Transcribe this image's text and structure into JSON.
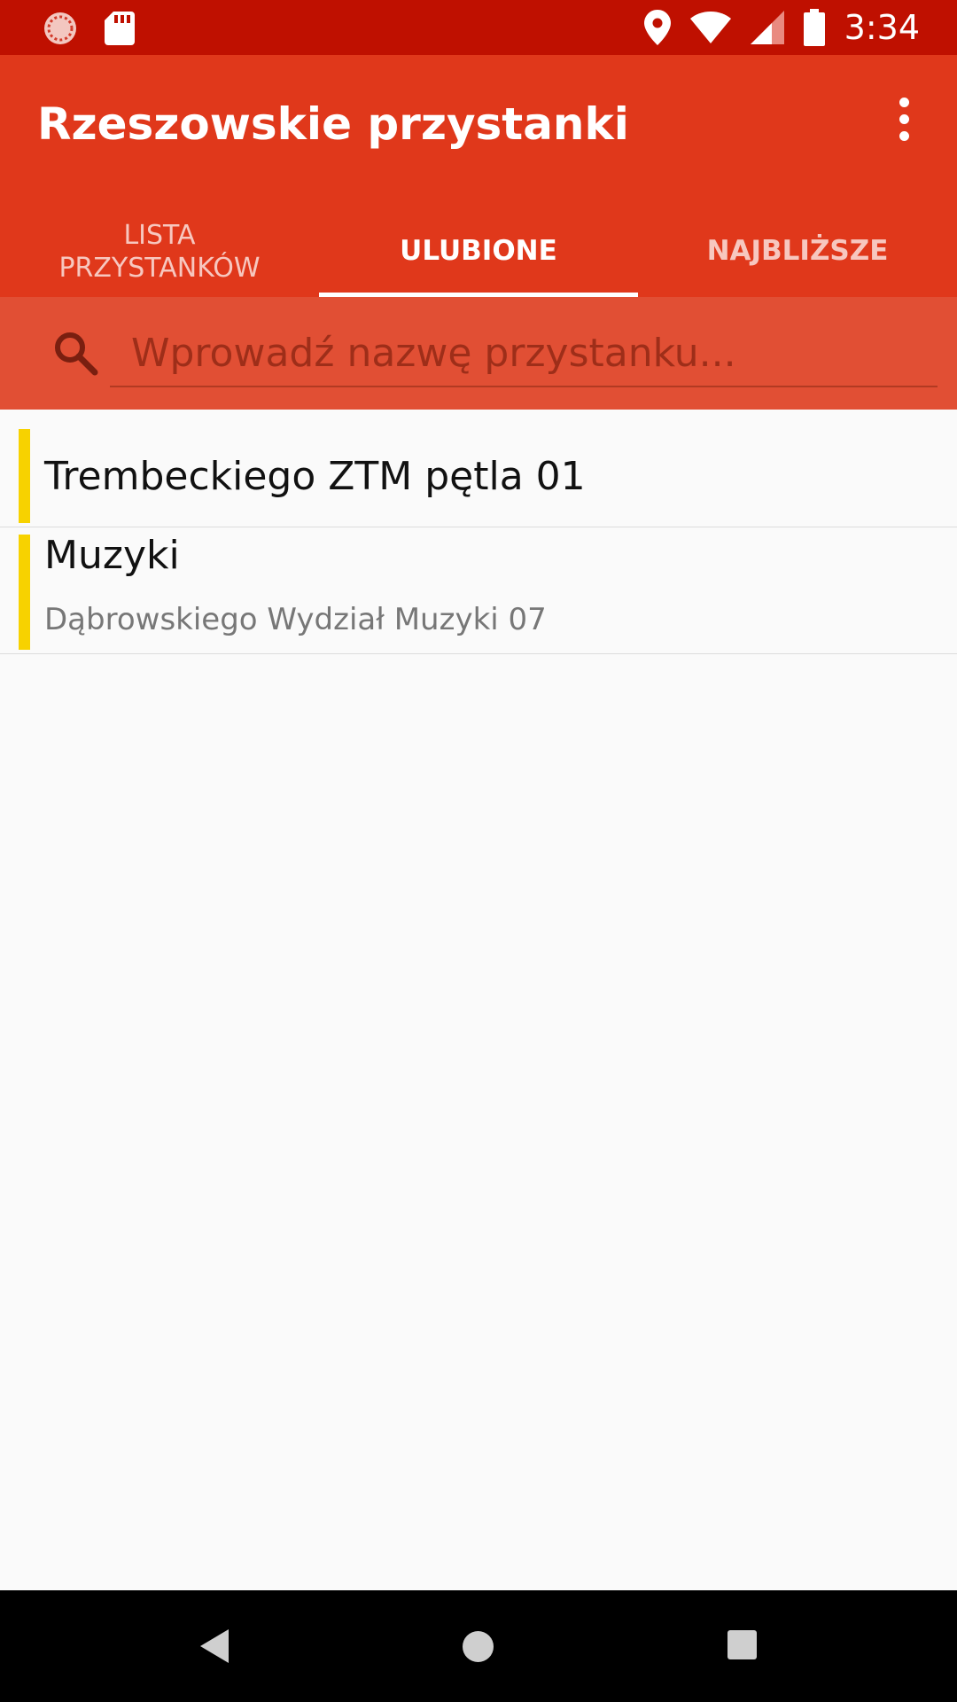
{
  "status_bar": {
    "time": "3:34",
    "left_icons": [
      "notification-dial-icon",
      "sd-card-icon"
    ],
    "right_icons": [
      "location-pin-icon",
      "wifi-icon",
      "signal-icon",
      "battery-icon"
    ]
  },
  "app_bar": {
    "title": "Rzeszowskie przystanki",
    "menu_icon": "more-vert-icon"
  },
  "tabs": [
    {
      "label": "LISTA PRZYSTANKÓW",
      "active": false
    },
    {
      "label": "ULUBIONE",
      "active": true
    },
    {
      "label": "NAJBLIŻSZE",
      "active": false
    }
  ],
  "search": {
    "placeholder": "Wprowadź nazwę przystanku...",
    "value": "",
    "icon": "search-icon"
  },
  "favorites": [
    {
      "title": "Trembeckiego ZTM pętla 01",
      "subtitle": ""
    },
    {
      "title": "Muzyki",
      "subtitle": "Dąbrowskiego Wydział Muzyki 07"
    }
  ],
  "colors": {
    "status_bar": "#bf1000",
    "app_bar": "#e0381b",
    "search_bar": "#e14f34",
    "favorite_marker": "#f7d200"
  },
  "nav_bar": {
    "buttons": [
      "back-icon",
      "home-icon",
      "recents-icon"
    ]
  }
}
